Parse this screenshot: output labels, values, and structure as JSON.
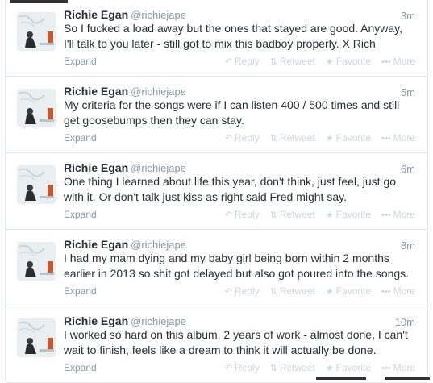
{
  "actions": {
    "expand": "Expand",
    "reply": "Reply",
    "retweet": "Retweet",
    "favorite": "Favorite",
    "more": "More"
  },
  "tweets": [
    {
      "name": "Richie Egan",
      "handle": "@richiejape",
      "time": "3m",
      "lines": [
        "So I fucked a load away but the ones that stayed are good. Anyway,",
        "I'll talk to you later - still got to mix this badboy properly. X Rich"
      ]
    },
    {
      "name": "Richie Egan",
      "handle": "@richiejape",
      "time": "5m",
      "lines": [
        "My criteria for the songs were if I can listen 400 / 500 times and still",
        "get goosebumps then they can stay."
      ]
    },
    {
      "name": "Richie Egan",
      "handle": "@richiejape",
      "time": "6m",
      "lines": [
        "One thing I learned about life this year, don't think, just feel, just go",
        "with it. Or don't talk just kiss as right said Fred might say."
      ]
    },
    {
      "name": "Richie Egan",
      "handle": "@richiejape",
      "time": "8m",
      "lines": [
        "I had my mam dying and my baby girl being born within 2 months",
        "earlier in 2013 so shit got delayed but also got poured into the songs."
      ]
    },
    {
      "name": "Richie Egan",
      "handle": "@richiejape",
      "time": "10m",
      "lines": [
        "I worked so hard on this album, 2 years of work - almost done, I can't",
        "wait to finish, feels like a dream to think it will actually be done."
      ]
    }
  ]
}
